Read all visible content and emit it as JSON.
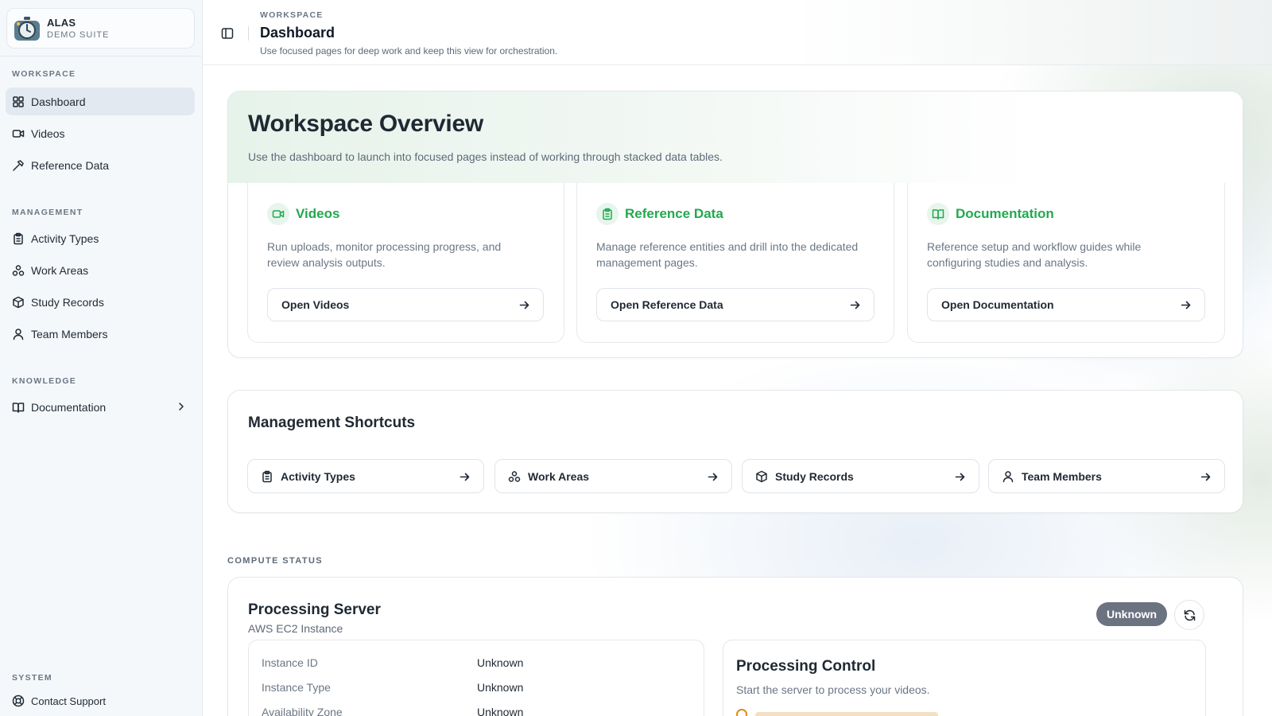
{
  "brand": {
    "name": "ALAS",
    "subtitle": "DEMO SUITE"
  },
  "sidebar": {
    "sections": {
      "workspace": "WORKSPACE",
      "management": "MANAGEMENT",
      "knowledge": "KNOWLEDGE",
      "system": "SYSTEM"
    },
    "items": {
      "dashboard": "Dashboard",
      "videos": "Videos",
      "reference_data": "Reference Data",
      "activity_types": "Activity Types",
      "work_areas": "Work Areas",
      "study_records": "Study Records",
      "team_members": "Team Members",
      "documentation": "Documentation",
      "contact_support": "Contact Support"
    },
    "active_item": "Dashboard"
  },
  "header": {
    "eyebrow": "WORKSPACE",
    "title": "Dashboard",
    "subtitle": "Use focused pages for deep work and keep this view for orchestration."
  },
  "overview": {
    "title": "Workspace Overview",
    "subtitle": "Use the dashboard to launch into focused pages instead of working through stacked data tables.",
    "cards": [
      {
        "title": "Videos",
        "icon": "video-icon",
        "description": "Run uploads, monitor processing progress, and review analysis outputs.",
        "button": "Open Videos"
      },
      {
        "title": "Reference Data",
        "icon": "clipboard-icon",
        "description": "Manage reference entities and drill into the dedicated management pages.",
        "button": "Open Reference Data"
      },
      {
        "title": "Documentation",
        "icon": "book-icon",
        "description": "Reference setup and workflow guides while configuring studies and analysis.",
        "button": "Open Documentation"
      }
    ]
  },
  "shortcuts": {
    "title": "Management Shortcuts",
    "items": [
      {
        "label": "Activity Types",
        "icon": "clipboard-icon"
      },
      {
        "label": "Work Areas",
        "icon": "workflow-icon"
      },
      {
        "label": "Study Records",
        "icon": "package-icon"
      },
      {
        "label": "Team Members",
        "icon": "user-icon"
      }
    ]
  },
  "compute": {
    "section_label": "COMPUTE STATUS",
    "server": {
      "title": "Processing Server",
      "subtitle": "AWS EC2 Instance",
      "status": "Unknown",
      "rows": [
        {
          "label": "Instance ID",
          "value": "Unknown"
        },
        {
          "label": "Instance Type",
          "value": "Unknown"
        },
        {
          "label": "Availability Zone",
          "value": "Unknown"
        }
      ]
    },
    "control": {
      "title": "Processing Control",
      "subtitle": "Start the server to process your videos."
    }
  },
  "colors": {
    "accent_green": "#22a94f",
    "status_unknown": "#6b7280",
    "warning": "#e08a1e"
  }
}
